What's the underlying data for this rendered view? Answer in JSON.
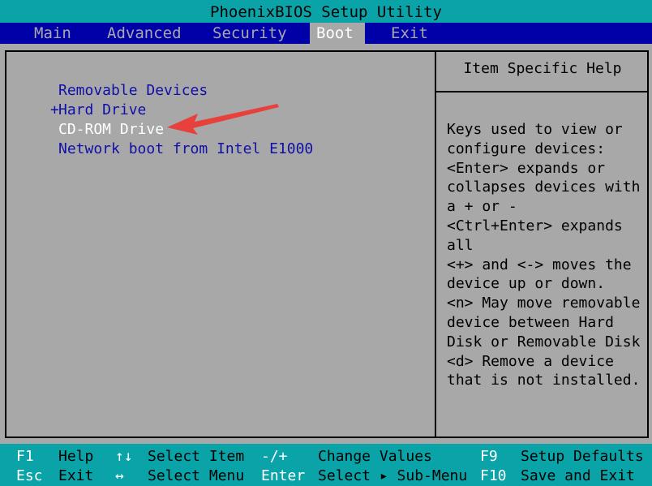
{
  "window": {
    "title": "PhoenixBIOS Setup Utility"
  },
  "menu": {
    "items": [
      {
        "label": "Main",
        "active": false
      },
      {
        "label": "Advanced",
        "active": false
      },
      {
        "label": "Security",
        "active": false
      },
      {
        "label": "Boot",
        "active": true
      },
      {
        "label": "Exit",
        "active": false
      }
    ]
  },
  "boot_list": {
    "items": [
      {
        "prefix": "",
        "label": "Removable Devices",
        "selected": false
      },
      {
        "prefix": "+",
        "label": "Hard Drive",
        "selected": false
      },
      {
        "prefix": "",
        "label": "CD-ROM Drive",
        "selected": true
      },
      {
        "prefix": "",
        "label": "Network boot from Intel E1000",
        "selected": false
      }
    ]
  },
  "help_panel": {
    "title": "Item Specific Help",
    "lines": [
      "Keys used to view or",
      "configure devices:",
      "<Enter> expands or",
      "collapses devices with",
      "a + or -",
      "<Ctrl+Enter> expands",
      "all",
      "<+> and <-> moves the",
      "device up or down.",
      "<n> May move removable",
      "device between Hard",
      "Disk or Removable Disk",
      "<d> Remove a device",
      "that is not installed."
    ]
  },
  "footer": {
    "row1": [
      {
        "key": "F1",
        "desc": "Help"
      },
      {
        "key": "↑↓",
        "desc": "Select Item"
      },
      {
        "key": "-/+",
        "desc": "Change Values"
      },
      {
        "key": "F9",
        "desc": "Setup Defaults"
      }
    ],
    "row2": [
      {
        "key": "Esc",
        "desc": "Exit"
      },
      {
        "key": "↔",
        "desc": "Select Menu"
      },
      {
        "key": "Enter",
        "desc": "Select ▸ Sub-Menu"
      },
      {
        "key": "F10",
        "desc": "Save and Exit"
      }
    ]
  },
  "colors": {
    "title_bar": "#0aa4a8",
    "menu_bar": "#0000a8",
    "panel": "#a8a8a8",
    "item_text": "#1010a8",
    "selected_text": "#ffffff",
    "annotation_arrow": "#e8403a"
  },
  "annotation": {
    "icon": "red-arrow-icon"
  }
}
